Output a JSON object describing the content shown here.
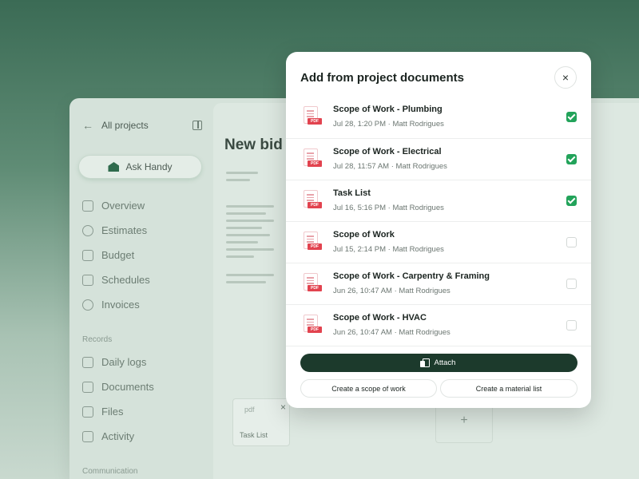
{
  "sidebar": {
    "back_label": "All projects",
    "ask_label": "Ask Handy",
    "main_items": [
      {
        "label": "Overview",
        "icon": "grid-plus-icon"
      },
      {
        "label": "Estimates",
        "icon": "chat-icon"
      },
      {
        "label": "Budget",
        "icon": "book-icon"
      },
      {
        "label": "Schedules",
        "icon": "calendar-icon"
      },
      {
        "label": "Invoices",
        "icon": "dollar-icon"
      }
    ],
    "records_label": "Records",
    "records_items": [
      {
        "label": "Daily logs",
        "icon": "user-check-icon"
      },
      {
        "label": "Documents",
        "icon": "documents-icon"
      },
      {
        "label": "Files",
        "icon": "folder-icon"
      },
      {
        "label": "Activity",
        "icon": "activity-icon"
      }
    ],
    "communication_label": "Communication"
  },
  "content": {
    "page_title": "New bid r",
    "tile_pdf": "pdf",
    "tile_label": "Task List"
  },
  "modal": {
    "title": "Add from project documents",
    "close_icon": "×",
    "items": [
      {
        "name": "Scope of Work - Plumbing",
        "meta": "Jul 28, 1:20 PM · Matt Rodrigues",
        "checked": true
      },
      {
        "name": "Scope of Work - Electrical",
        "meta": "Jul 28, 11:57 AM · Matt Rodrigues",
        "checked": true
      },
      {
        "name": "Task List",
        "meta": "Jul 16, 5:16 PM · Matt Rodrigues",
        "checked": true
      },
      {
        "name": "Scope of Work",
        "meta": "Jul 15, 2:14 PM · Matt Rodrigues",
        "checked": false
      },
      {
        "name": "Scope of Work - Carpentry & Framing",
        "meta": "Jun 26, 10:47 AM · Matt Rodrigues",
        "checked": false
      },
      {
        "name": "Scope of Work - HVAC",
        "meta": "Jun 26, 10:47 AM · Matt Rodrigues",
        "checked": false
      }
    ],
    "pdf_tag": "PDF",
    "attach_label": "Attach",
    "scope_button_label": "Create a scope of work",
    "material_button_label": "Create a material list"
  },
  "colors": {
    "accent_dark": "#1c3a2c",
    "check_green": "#22a35a",
    "pdf_red": "#e2434f"
  }
}
